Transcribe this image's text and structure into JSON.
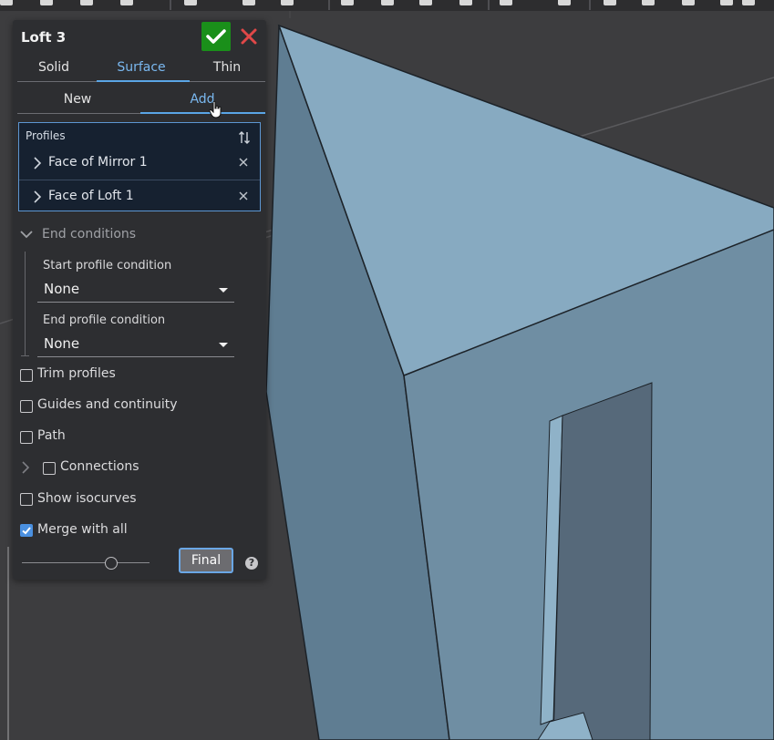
{
  "panel": {
    "title": "Loft 3",
    "confirm_icon": "check-icon",
    "cancel_icon": "close-icon",
    "type_tabs": [
      {
        "label": "Solid",
        "active": false
      },
      {
        "label": "Surface",
        "active": true
      },
      {
        "label": "Thin",
        "active": false
      }
    ],
    "op_tabs": [
      {
        "label": "New",
        "active": false
      },
      {
        "label": "Add",
        "active": true
      }
    ],
    "profiles": {
      "label": "Profiles",
      "items": [
        "Face of Mirror 1",
        "Face of Loft 1"
      ]
    },
    "end_conditions": {
      "label": "End conditions",
      "start_label": "Start profile condition",
      "start_value": "None",
      "end_label": "End profile condition",
      "end_value": "None"
    },
    "options": [
      {
        "label": "Trim profiles",
        "checked": false
      },
      {
        "label": "Guides and continuity",
        "checked": false
      },
      {
        "label": "Path",
        "checked": false
      },
      {
        "label": "Connections",
        "checked": false,
        "expandable": true
      },
      {
        "label": "Show isocurves",
        "checked": false
      },
      {
        "label": "Merge with all",
        "checked": true
      }
    ],
    "slider_level": 0.7,
    "final_label": "Final",
    "help_icon": "?"
  },
  "colors": {
    "accent": "#5aa5e6",
    "confirm": "#1a8f1a",
    "cancel": "#e04848",
    "model_top": "#87aac1",
    "model_front": "#6f8ea3",
    "model_side": "#5f7d92",
    "background": "#3d3d3f"
  }
}
